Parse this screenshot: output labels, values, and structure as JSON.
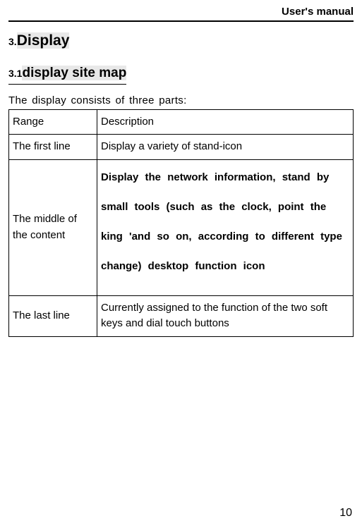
{
  "header": {
    "title": "User's manual"
  },
  "section": {
    "number": "3.",
    "title": "Display"
  },
  "subsection": {
    "number": "3.1",
    "title": "display site  map"
  },
  "intro": "The  display consists  of  three  parts:",
  "table": {
    "header": {
      "col1": "Range",
      "col2": "Description"
    },
    "rows": [
      {
        "col1": "The  first  line",
        "col2": "Display  a  variety  of stand-icon"
      },
      {
        "col1": "The  middle  of the  content",
        "col2": "Display  the  network  information,  stand by  small  tools  (such  as  the  clock,  point  the  king  'and  so  on,  according  to different  type  change)  desktop  function  icon"
      },
      {
        "col1": "The  last  line",
        "col2": "Currently  assigned  to  the function of the  two  soft  keys and dial touch buttons"
      }
    ]
  },
  "pageNumber": "10"
}
